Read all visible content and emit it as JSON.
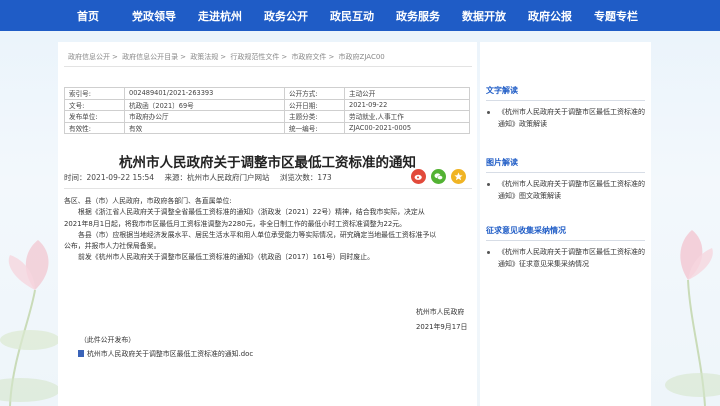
{
  "nav": {
    "items": [
      "首页",
      "党政领导",
      "走进杭州",
      "政务公开",
      "政民互动",
      "政务服务",
      "数据开放",
      "政府公报",
      "专题专栏"
    ]
  },
  "breadcrumb": [
    "政府信息公开",
    "政府信息公开目录",
    "政策法规",
    "行政规范性文件",
    "市政府文件",
    "市政府ZJAC00"
  ],
  "meta": {
    "rows": [
      {
        "k1": "索引号:",
        "v1": "002489401/2021-263393",
        "k2": "公开方式:",
        "v2": "主动公开"
      },
      {
        "k1": "文号:",
        "v1": "杭政函〔2021〕69号",
        "k2": "公开日期:",
        "v2": "2021-09-22"
      },
      {
        "k1": "发布单位:",
        "v1": "市政府办公厅",
        "k2": "主题分类:",
        "v2": "劳动就业,人事工作"
      },
      {
        "k1": "有效性:",
        "v1": "有效",
        "k2": "统一编号:",
        "v2": "ZJAC00-2021-0005"
      }
    ]
  },
  "article": {
    "title": "杭州市人民政府关于调整市区最低工资标准的通知",
    "time": "时间：2021-09-22 15:54",
    "source": "来源：杭州市人民政府门户网站",
    "views": "浏览次数：173",
    "paragraphs": [
      "各区、县（市）人民政府，市政府各部门、各直属单位:",
      "根据《浙江省人民政府关于调整全省最低工资标准的通知》（浙政发〔2021〕22号）精神，结合我市实际，决定从",
      "2021年8月1日起，将我市市区最低月工资标准调整为2280元，非全日制工作的最低小时工资标准调整为22元。",
      "各县（市）应根据当地经济发展水平、居民生活水平和用人单位承受能力等实际情况，研究确定当地最低工资标准予以",
      "公布，并报市人力社保局备案。",
      "前发《杭州市人民政府关于调整市区最低工资标准的通知》（杭政函〔2017〕161号）同时废止。"
    ],
    "signer": "杭州市人民政府",
    "date": "2021年9月17日",
    "note": "（此件公开发布）",
    "attachment": "杭州市人民政府关于调整市区最低工资标准的通知.doc"
  },
  "sidebar": {
    "sections": [
      {
        "title": "文字解读",
        "link": "《杭州市人民政府关于调整市区最低工资标准的通知》政策解读"
      },
      {
        "title": "图片解读",
        "link": "《杭州市人民政府关于调整市区最低工资标准的通知》图文政策解读"
      },
      {
        "title": "征求意见收集采纳情况",
        "link": "《杭州市人民政府关于调整市区最低工资标准的通知》征求意见采集采纳情况"
      }
    ]
  },
  "colors": {
    "nav_bg": "#1f5cc6",
    "accent": "#1f5cc6",
    "weibo": "#e24a3b",
    "wechat": "#53b233",
    "fav": "#f0b424"
  }
}
